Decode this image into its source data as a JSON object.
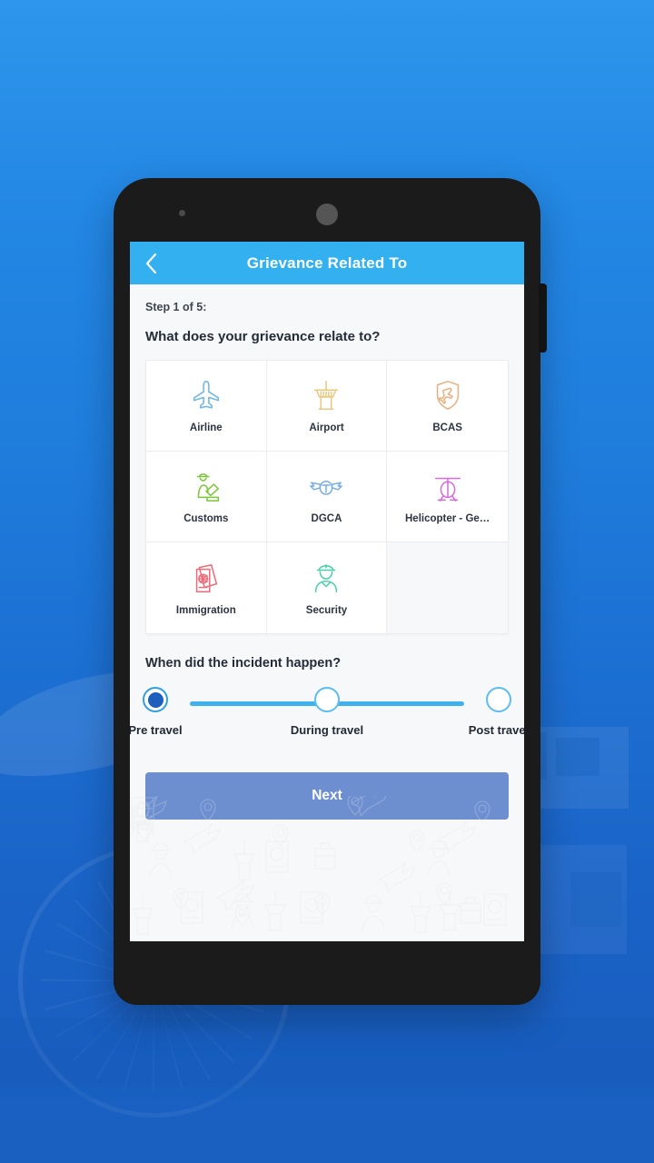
{
  "app": {
    "header": {
      "title": "Grievance Related To",
      "back_icon": "chevron-left-icon",
      "bg_color": "#33b0f0"
    },
    "step_label": "Step 1 of 5:",
    "question_1": "What does your grievance relate to?",
    "categories": [
      {
        "label": "Airline",
        "icon": "airplane-icon",
        "color": "#6cb5e8"
      },
      {
        "label": "Airport",
        "icon": "control-tower-icon",
        "color": "#e7c980"
      },
      {
        "label": "BCAS",
        "icon": "shield-plane-icon",
        "color": "#e8b183"
      },
      {
        "label": "Customs",
        "icon": "customs-officer-icon",
        "color": "#7cc638"
      },
      {
        "label": "DGCA",
        "icon": "pilot-wings-icon",
        "color": "#79aee6"
      },
      {
        "label": "Helicopter - Ge…",
        "icon": "helicopter-icon",
        "color": "#d96ae0"
      },
      {
        "label": "Immigration",
        "icon": "passport-icon",
        "color": "#ef6b79"
      },
      {
        "label": "Security",
        "icon": "security-officer-icon",
        "color": "#4ad0a8"
      }
    ],
    "question_2": "When did the incident happen?",
    "timeline": {
      "options": [
        {
          "label": "Pre travel",
          "selected": true
        },
        {
          "label": "During travel",
          "selected": false
        },
        {
          "label": "Post travel",
          "selected": false
        }
      ],
      "track_color": "#3fb1ef",
      "selected_dot_color": "#1e5fbe"
    },
    "next_label": "Next",
    "next_color": "#6d8fd0"
  }
}
